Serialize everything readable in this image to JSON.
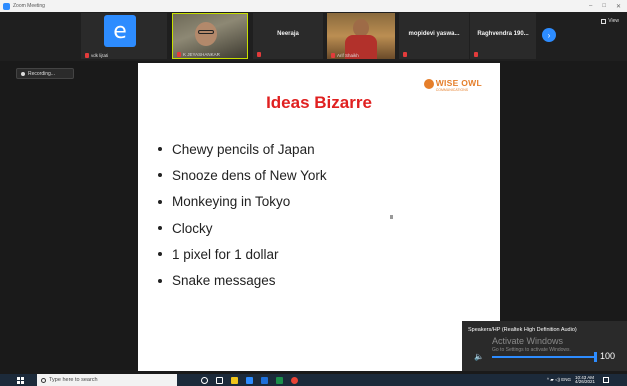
{
  "window": {
    "title": "Zoom Meeting",
    "controls": [
      "–",
      "□",
      "✕"
    ]
  },
  "participants": [
    {
      "name": "vdk lijtati",
      "avatar_letter": "e"
    },
    {
      "name": "K JEYASHANKAR",
      "video": true
    },
    {
      "name": "Neeraja"
    },
    {
      "name": "Arif Shaikh",
      "video": true
    },
    {
      "name": "mopidevi yaswa..."
    },
    {
      "name": "Raghvendra 190..."
    }
  ],
  "next_button": "›",
  "view_label": "View",
  "recording_label": "Recording...",
  "slide": {
    "title": "Ideas Bizarre",
    "logo_text": "WISE OWL",
    "logo_subtext": "COMMUNICATIONS",
    "bullets": [
      "Chewy pencils of Japan",
      "Snooze dens of New York",
      "Monkeying in Tokyo",
      "Clocky",
      "1 pixel for 1 dollar",
      "Snake messages"
    ]
  },
  "audio_popup": {
    "device": "Speakers/HP (Realtek High Definition Audio)",
    "activate_title": "Activate Windows",
    "activate_sub": "Go to Settings to activate Windows.",
    "volume": "100",
    "volume_level": 1.0
  },
  "taskbar": {
    "search_placeholder": "Type here to search",
    "tray_text": "^ ▰ ◁) ENG",
    "time": "10:43 AM",
    "date": "4/26/2021"
  },
  "colors": {
    "accent": "#2d8cff",
    "slide_title": "#e02020",
    "logo": "#e57e2a"
  }
}
